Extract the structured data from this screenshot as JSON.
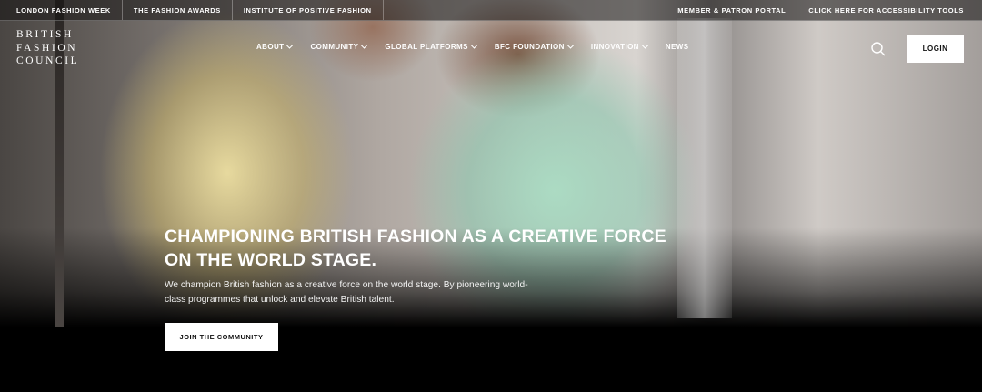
{
  "topbar": {
    "left": [
      "LONDON FASHION WEEK",
      "THE FASHION AWARDS",
      "INSTITUTE OF POSITIVE FASHION"
    ],
    "right": [
      "MEMBER & PATRON PORTAL",
      "CLICK HERE FOR ACCESSIBILITY TOOLS"
    ]
  },
  "logo": {
    "lines": [
      "BRITISH",
      "FASHION",
      "COUNCIL"
    ]
  },
  "nav": {
    "items": [
      {
        "label": "ABOUT",
        "has_dropdown": true
      },
      {
        "label": "COMMUNITY",
        "has_dropdown": true
      },
      {
        "label": "GLOBAL PLATFORMS",
        "has_dropdown": true
      },
      {
        "label": "BFC FOUNDATION",
        "has_dropdown": true
      },
      {
        "label": "INNOVATION",
        "has_dropdown": true
      },
      {
        "label": "NEWS",
        "has_dropdown": false
      }
    ],
    "search_icon": "search-icon",
    "login_label": "LOGIN"
  },
  "hero": {
    "title": "CHAMPIONING BRITISH FASHION AS A CREATIVE FORCE ON THE WORLD STAGE.",
    "description": "We champion British fashion as a creative force on the world stage. By pioneering world-class programmes that unlock and elevate British talent.",
    "cta_label": "JOIN THE COMMUNITY"
  },
  "colors": {
    "button_bg": "#ffffff",
    "button_text": "#111111",
    "background": "#000000"
  }
}
